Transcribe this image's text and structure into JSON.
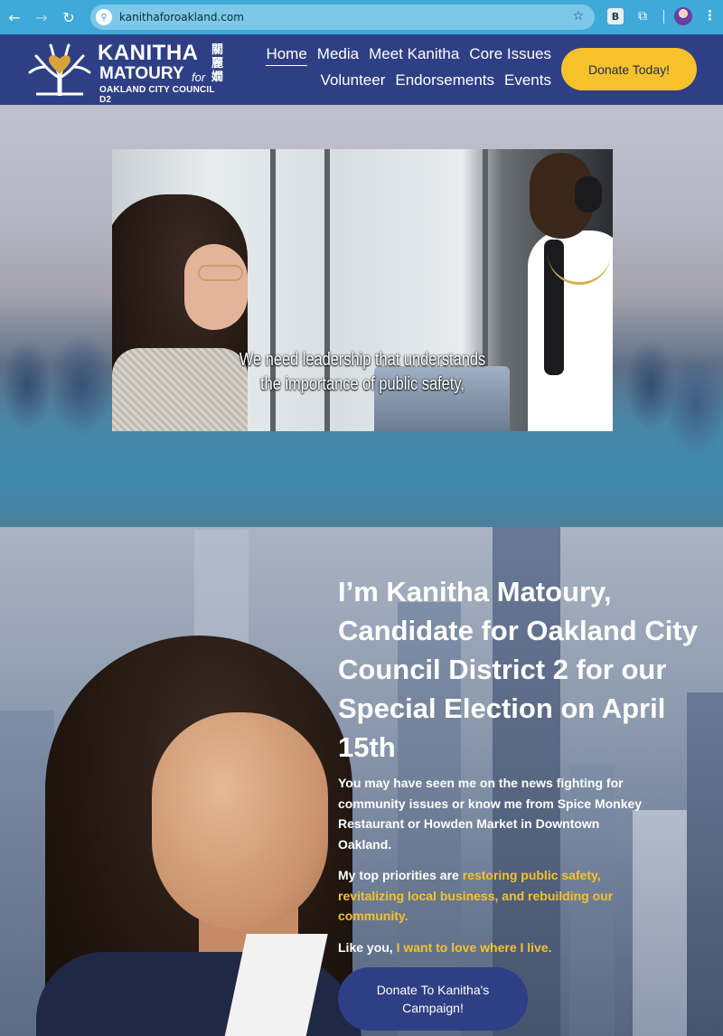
{
  "browser": {
    "url": "kanithaforoakland.com",
    "back_icon": "←",
    "forward_icon": "→",
    "reload_icon": "↻",
    "site_icon": "⚲",
    "star_icon": "☆",
    "ext_b_label": "B",
    "puzzle_icon": "⧉",
    "menu_icon": "⋮"
  },
  "logo": {
    "name_line1": "KANITHA",
    "name_line2": "MATOURY",
    "for": "for",
    "cjk": "關麗嫺",
    "subtitle": "OAKLAND CITY COUNCIL D2"
  },
  "nav": {
    "row1": [
      "Home",
      "Media",
      "Meet Kanitha",
      "Core Issues"
    ],
    "row2": [
      "Volunteer",
      "Endorsements",
      "Events"
    ]
  },
  "header": {
    "donate_label": "Donate Today!"
  },
  "video": {
    "caption_line1": "We need leadership that understands",
    "caption_line2": "the importance of public safety,"
  },
  "candidate": {
    "headline": "I’m Kanitha Matoury, Candidate for Oakland City Council District 2 for our Special Election on April 15th",
    "para1": "You may have seen me on the news fighting for community issues or know me from Spice Monkey Restaurant or Howden Market in Downtown Oakland.",
    "para2_prefix": "My top priorities are ",
    "para2_highlight": "restoring public safety, revitalizing local business, and rebuilding our community.",
    "para3_prefix": "Like you, ",
    "para3_highlight": "I want to love where I live.",
    "donate_label": "Donate To Kanitha's Campaign!"
  },
  "colors": {
    "brand_navy": "#2f3f86",
    "accent_yellow": "#f7c12a",
    "browser_blue": "#3fa9d9"
  }
}
